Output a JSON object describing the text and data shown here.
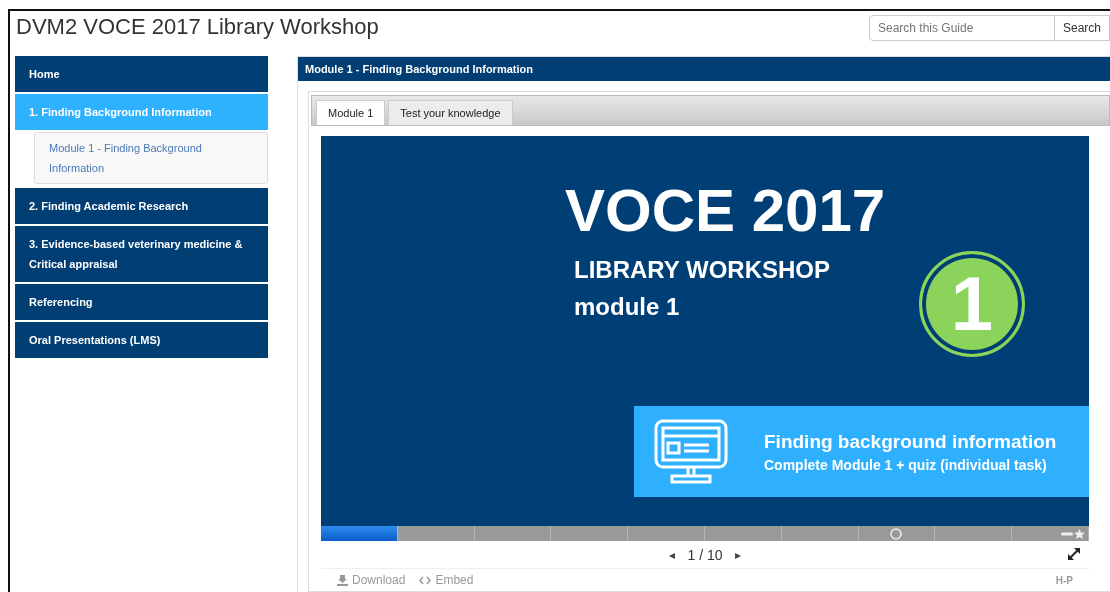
{
  "page": {
    "title": "DVM2 VOCE 2017 Library Workshop"
  },
  "search": {
    "placeholder": "Search this Guide",
    "button": "Search"
  },
  "sidebar": {
    "items": [
      {
        "label": "Home",
        "selected": false
      },
      {
        "label": "1. Finding Background Information",
        "selected": true,
        "children": [
          {
            "label": "Module 1 - Finding Background Information"
          }
        ]
      },
      {
        "label": "2. Finding Academic Research",
        "selected": false
      },
      {
        "label": "3. Evidence-based veterinary medicine & Critical appraisal",
        "selected": false
      },
      {
        "label": "Referencing",
        "selected": false
      },
      {
        "label": "Oral Presentations (LMS)",
        "selected": false
      }
    ]
  },
  "panel": {
    "title": "Module 1 - Finding Background Information",
    "tabs": [
      {
        "label": "Module 1",
        "selected": true
      },
      {
        "label": "Test your knowledge",
        "selected": false
      }
    ],
    "slide": {
      "heading": "VOCE 2017",
      "subheading": "LIBRARY WORKSHOP",
      "module": "module 1",
      "badge": "1",
      "callout_title": "Finding background information",
      "callout_text": "Complete Module 1 + quiz (individual task)"
    },
    "progress": {
      "level": 0.1
    },
    "nav": {
      "prev": "◂",
      "counter": "1 / 10",
      "next": "▸"
    },
    "footer": {
      "download": "Download",
      "embed": "Embed",
      "logo": "H-P"
    }
  }
}
